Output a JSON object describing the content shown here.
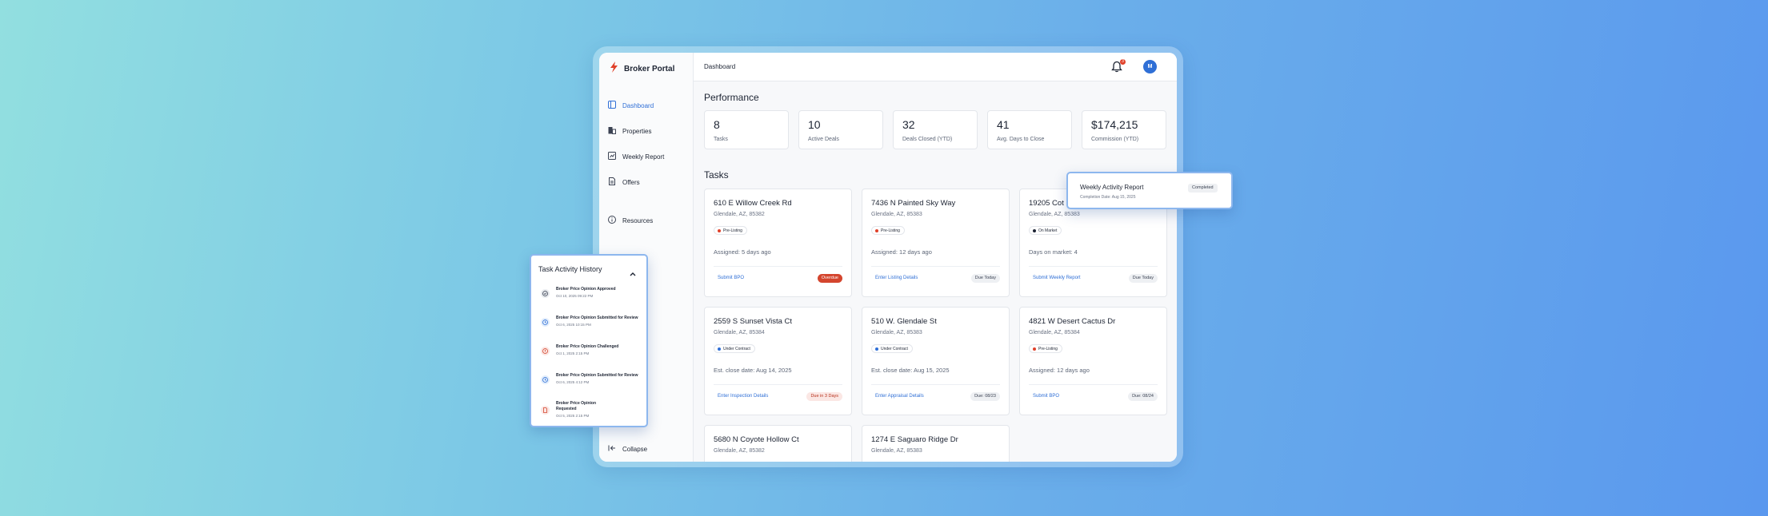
{
  "app": {
    "brand": "Broker Portal",
    "breadcrumb": "Dashboard",
    "notification_count": "3",
    "avatar_initial": "M"
  },
  "sidebar": {
    "items": [
      {
        "label": "Dashboard",
        "icon": "dashboard-icon",
        "active": true
      },
      {
        "label": "Properties",
        "icon": "building-icon"
      },
      {
        "label": "Weekly Report",
        "icon": "report-icon"
      },
      {
        "label": "Offers",
        "icon": "document-icon"
      },
      {
        "label": "Resources",
        "icon": "info-icon"
      }
    ],
    "collapse_label": "Collapse"
  },
  "performance": {
    "title": "Performance",
    "kpis": [
      {
        "value": "8",
        "label": "Tasks"
      },
      {
        "value": "10",
        "label": "Active Deals"
      },
      {
        "value": "32",
        "label": "Deals Closed (YTD)"
      },
      {
        "value": "41",
        "label": "Avg. Days to Close"
      },
      {
        "value": "$174,215",
        "label": "Commission (YTD)"
      }
    ]
  },
  "tasks": {
    "title": "Tasks",
    "cards": [
      {
        "address": "610 E Willow Creek Rd",
        "city": "Glendale, AZ, 85382",
        "status": "Pre-Listing",
        "status_color": "#e0412a",
        "meta": "Assigned: 5 days ago",
        "action": "Submit BPO",
        "due": "Overdue"
      },
      {
        "address": "7436 N Painted Sky Way",
        "city": "Glendale, AZ, 85383",
        "status": "Pre-Listing",
        "status_color": "#e0412a",
        "meta": "Assigned: 12 days ago",
        "action": "Enter Listing Details",
        "due": "Due Today"
      },
      {
        "address": "19205 Cot",
        "city": "Glendale, AZ, 85383",
        "status": "On Market",
        "status_color": "#1d2433",
        "meta": "Days on market: 4",
        "action": "Submit Weekly Report",
        "due": "Due Today"
      },
      {
        "address": "2559 S Sunset Vista Ct",
        "city": "Glendale, AZ, 85384",
        "status": "Under Contract",
        "status_color": "#2f6fd6",
        "meta": "Est. close date: Aug 14, 2025",
        "action": "Enter Inspection Details",
        "due": "Due in 3 Days"
      },
      {
        "address": "510 W. Glendale St",
        "city": "Glendale, AZ, 85383",
        "status": "Under Contract",
        "status_color": "#2f6fd6",
        "meta": "Est. close date: Aug 15, 2025",
        "action": "Enter Appraisal Details",
        "due": "Due: 08/23"
      },
      {
        "address": "4821 W Desert Cactus Dr",
        "city": "Glendale, AZ, 85384",
        "status": "Pre-Listing",
        "status_color": "#e0412a",
        "meta": "Assigned: 12 days ago",
        "action": "Submit BPO",
        "due": "Due: 08/24"
      },
      {
        "address": "5680 N Coyote Hollow Ct",
        "city": "Glendale, AZ, 85382"
      },
      {
        "address": "1274 E Saguaro Ridge Dr",
        "city": "Glendale, AZ, 85383"
      }
    ]
  },
  "weekly_popup": {
    "title": "Weekly Activity Report",
    "subtitle": "Completion Date: Aug 15, 2025",
    "status": "Completed"
  },
  "history": {
    "title": "Task Activity History",
    "items": [
      {
        "title": "Broker Price Opinion Approved",
        "date": "Oct 10, 2025 09:22 PM",
        "kind": "approved"
      },
      {
        "title": "Broker Price Opinion Submitted for Review",
        "date": "Oct 6, 2025 10:15 PM",
        "kind": "submitted"
      },
      {
        "title": "Broker Price Opinion Challenged",
        "date": "Oct 1, 2025 2:15 PM",
        "kind": "challenged"
      },
      {
        "title": "Broker Price Opinion Submitted for Review",
        "date": "Oct 6, 2025 4:12 PM",
        "kind": "submitted"
      },
      {
        "title": "Broker Price Opinion Requested",
        "date": "Oct 5, 2025 2:15 PM",
        "kind": "requested"
      }
    ]
  },
  "colors": {
    "accent": "#2f6fd6",
    "danger": "#e0412a"
  }
}
